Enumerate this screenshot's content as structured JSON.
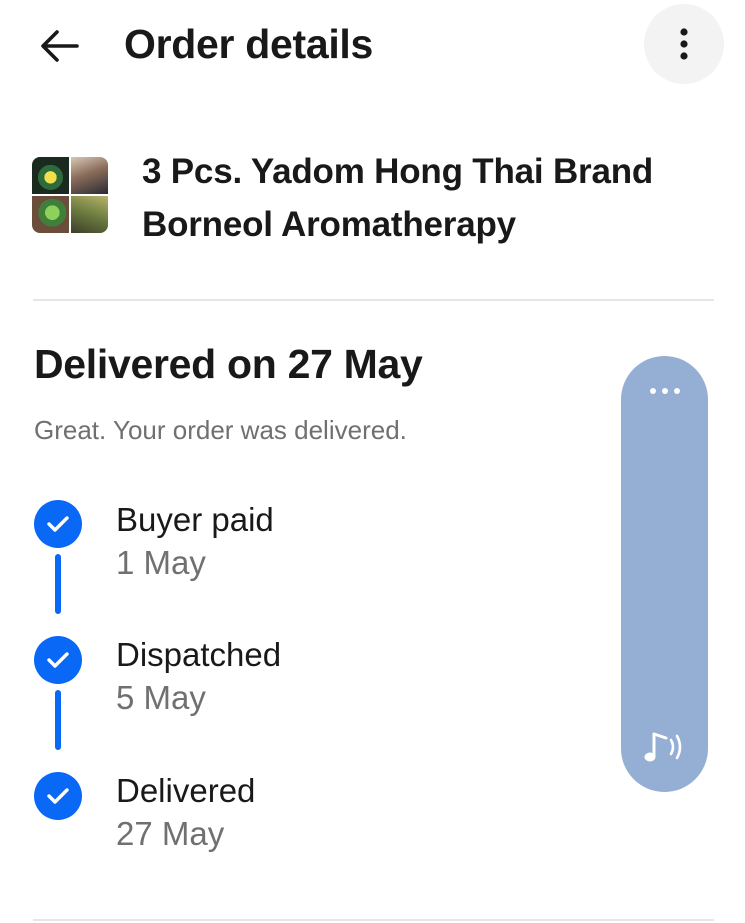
{
  "header": {
    "title": "Order details",
    "back_icon": "arrow-left-icon",
    "more_icon": "more-vertical-icon"
  },
  "item": {
    "title_line1": "3 Pcs. Yadom Hong Thai Brand",
    "title_line2": "Borneol Aromatherapy",
    "thumbnail_icon": "product-thumbnail"
  },
  "status": {
    "heading": "Delivered on 27 May",
    "message": "Great. Your order was delivered."
  },
  "timeline": [
    {
      "label": "Buyer paid",
      "date": "1 May",
      "done": true
    },
    {
      "label": "Dispatched",
      "date": "5 May",
      "done": true
    },
    {
      "label": "Delivered",
      "date": "27 May",
      "done": true
    }
  ],
  "side_panel": {
    "menu_icon": "more-horizontal-icon",
    "sound_icon": "music-note-sound-icon"
  },
  "colors": {
    "accent": "#0968f6",
    "text_primary": "#191919",
    "text_secondary": "#707070",
    "divider": "#e6e6e6",
    "side_panel": "#94afd3",
    "more_button_bg": "#f3f3f3"
  }
}
